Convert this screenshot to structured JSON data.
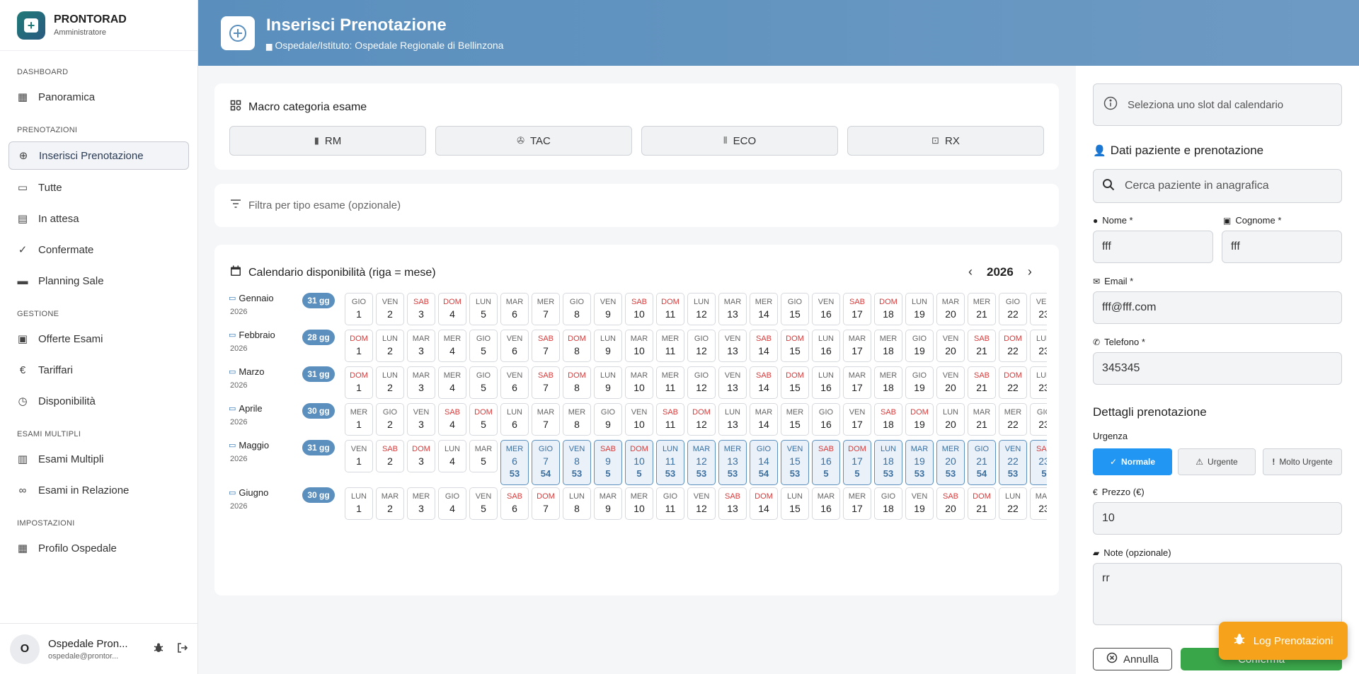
{
  "brand": {
    "name": "PRONTORAD",
    "role": "Amministratore"
  },
  "sidebar": {
    "sections": [
      {
        "title": "DASHBOARD",
        "items": [
          {
            "label": "Panoramica",
            "icon": "dashboard-icon"
          }
        ]
      },
      {
        "title": "PRENOTAZIONI",
        "items": [
          {
            "label": "Inserisci Prenotazione",
            "icon": "add-circle-icon",
            "active": true
          },
          {
            "label": "Tutte",
            "icon": "calendar-icon"
          },
          {
            "label": "In attesa",
            "icon": "clipboard-clock-icon"
          },
          {
            "label": "Confermate",
            "icon": "check-circle-icon"
          },
          {
            "label": "Planning Sale",
            "icon": "monitor-icon"
          }
        ]
      },
      {
        "title": "GESTIONE",
        "items": [
          {
            "label": "Offerte Esami",
            "icon": "medical-bag-icon"
          },
          {
            "label": "Tariffari",
            "icon": "euro-icon"
          },
          {
            "label": "Disponibilità",
            "icon": "clock-icon"
          }
        ]
      },
      {
        "title": "ESAMI MULTIPLI",
        "items": [
          {
            "label": "Esami Multipli",
            "icon": "tray-icon"
          },
          {
            "label": "Esami in Relazione",
            "icon": "link-icon"
          }
        ]
      },
      {
        "title": "IMPOSTAZIONI",
        "items": [
          {
            "label": "Profilo Ospedale",
            "icon": "building-icon"
          }
        ]
      }
    ]
  },
  "user": {
    "initial": "O",
    "name": "Ospedale Pron...",
    "email": "ospedale@prontor..."
  },
  "header": {
    "title": "Inserisci Prenotazione",
    "subtitle": "Ospedale/Istituto: Ospedale Regionale di Bellinzona"
  },
  "macro": {
    "title": "Macro categoria esame",
    "buttons": [
      {
        "label": "RM",
        "icon": "bar-chart-icon"
      },
      {
        "label": "TAC",
        "icon": "aperture-icon"
      },
      {
        "label": "ECO",
        "icon": "soundwave-icon"
      },
      {
        "label": "RX",
        "icon": "scan-icon"
      }
    ]
  },
  "filter": {
    "placeholder": "Filtra per tipo esame (opzionale)"
  },
  "calendar": {
    "title": "Calendario disponibilità (riga = mese)",
    "year": "2026",
    "months": [
      {
        "name": "Gennaio",
        "year": "2026",
        "badge": "31 gg",
        "firstDow": 3
      },
      {
        "name": "Febbraio",
        "year": "2026",
        "badge": "28 gg",
        "firstDow": 6
      },
      {
        "name": "Marzo",
        "year": "2026",
        "badge": "31 gg",
        "firstDow": 6
      },
      {
        "name": "Aprile",
        "year": "2026",
        "badge": "30 gg",
        "firstDow": 2
      },
      {
        "name": "Maggio",
        "year": "2026",
        "badge": "31 gg",
        "firstDow": 4,
        "slots": {
          "6": "53",
          "7": "54",
          "8": "53",
          "9": "5",
          "10": "5",
          "11": "53",
          "12": "53",
          "13": "53",
          "14": "54",
          "15": "53",
          "16": "5",
          "17": "5",
          "18": "53",
          "19": "53",
          "20": "53",
          "21": "54",
          "22": "53",
          "23": "5"
        }
      },
      {
        "name": "Giugno",
        "year": "2026",
        "badge": "30 gg",
        "firstDow": 0
      }
    ],
    "dow": [
      "LUN",
      "MAR",
      "MER",
      "GIO",
      "VEN",
      "SAB",
      "DOM"
    ]
  },
  "panel": {
    "slot_hint": "Seleziona uno slot dal calendario",
    "patient_title": "Dati paziente e prenotazione",
    "search_placeholder": "Cerca paziente in anagrafica",
    "nome_label": "Nome *",
    "nome_value": "fff",
    "cognome_label": "Cognome *",
    "cognome_value": "fff",
    "email_label": "Email *",
    "email_value": "fff@fff.com",
    "telefono_label": "Telefono *",
    "telefono_value": "345345",
    "details_title": "Dettagli prenotazione",
    "urgenza_label": "Urgenza",
    "urgenza": [
      {
        "label": "Normale",
        "selected": true
      },
      {
        "label": "Urgente"
      },
      {
        "label": "Molto Urgente"
      }
    ],
    "prezzo_label": "Prezzo (€)",
    "prezzo_value": "10",
    "note_label": "Note (opzionale)",
    "note_value": "rr",
    "cancel_label": "Annulla",
    "confirm_label": "Conferma"
  },
  "log_button": "Log Prenotazioni",
  "colors": {
    "accent": "#5b8fbd",
    "primary_blue": "#2196f3",
    "weekend": "#d83a3a",
    "confirm": "#3aa64a",
    "log": "#f7a21b"
  }
}
